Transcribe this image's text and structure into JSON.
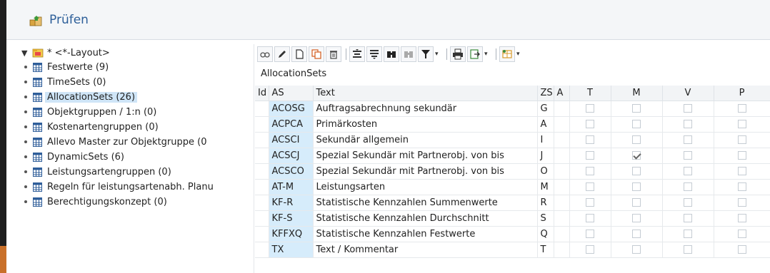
{
  "window": {
    "title": "Prüfen"
  },
  "tree": {
    "root_label": "* <*-Layout>",
    "items": [
      {
        "label": "Festwerte (9)"
      },
      {
        "label": "TimeSets (0)"
      },
      {
        "label": "AllocationSets (26)",
        "selected": true
      },
      {
        "label": "Objektgruppen / 1:n (0)"
      },
      {
        "label": "Kostenartengruppen (0)"
      },
      {
        "label": "Allevo Master zur Objektgruppe (0"
      },
      {
        "label": "DynamicSets (6)"
      },
      {
        "label": "Leistungsartengruppen (0)"
      },
      {
        "label": "Regeln für leistungsartenabh. Planu"
      },
      {
        "label": "Berechtigungskonzept (0)"
      }
    ]
  },
  "toolbar": {
    "buttons": [
      "details-icon",
      "edit-icon",
      "create-icon",
      "copy-icon",
      "delete-icon",
      "sort-asc-icon",
      "sort-desc-icon",
      "find-icon",
      "find-next-icon",
      "filter-icon",
      "print-icon",
      "export-icon",
      "layout-icon"
    ]
  },
  "grid": {
    "title": "AllocationSets",
    "columns": [
      "Id",
      "AS",
      "Text",
      "ZS",
      "A",
      "T",
      "M",
      "V",
      "P"
    ],
    "rows": [
      {
        "as": "ACOSG",
        "text": "Auftragsabrechnung sekundär",
        "zs": "G",
        "m": false
      },
      {
        "as": "ACPCA",
        "text": "Primärkosten",
        "zs": "A",
        "m": false
      },
      {
        "as": "ACSCI",
        "text": "Sekundär allgemein",
        "zs": "I",
        "m": false
      },
      {
        "as": "ACSCJ",
        "text": "Spezial Sekundär mit Partnerobj. von bis",
        "zs": "J",
        "m": true
      },
      {
        "as": "ACSCO",
        "text": "Spezial Sekundär mit Partnerobj. von bis",
        "zs": "O",
        "m": false
      },
      {
        "as": "AT-M",
        "text": "Leistungsarten",
        "zs": "M",
        "m": false
      },
      {
        "as": "KF-R",
        "text": "Statistische Kennzahlen Summenwerte",
        "zs": "R",
        "m": false
      },
      {
        "as": "KF-S",
        "text": "Statistische Kennzahlen Durchschnitt",
        "zs": "S",
        "m": false
      },
      {
        "as": "KFFXQ",
        "text": "Statistische Kennzahlen Festwerte",
        "zs": "Q",
        "m": false
      },
      {
        "as": "TX",
        "text": "Text / Kommentar",
        "zs": "T",
        "m": false
      }
    ]
  },
  "colors": {
    "selected_bg": "#cfe5f7",
    "as_cell_bg": "#d6ecfb",
    "title_text": "#2d5f99"
  }
}
